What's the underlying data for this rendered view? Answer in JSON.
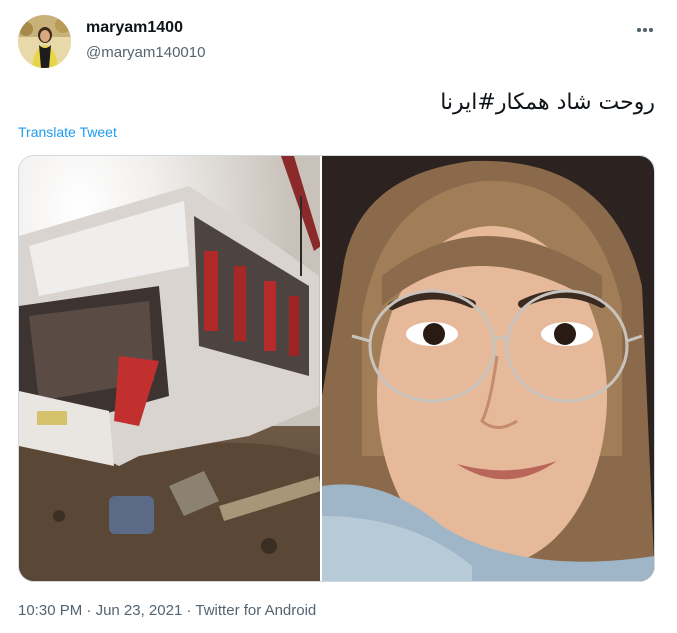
{
  "tweet": {
    "author": {
      "display_name": "maryam1400",
      "handle": "@maryam140010",
      "avatar_icon": "profile-avatar"
    },
    "more_icon": "more-options-icon",
    "text": "روحت شاد همکار#ایرنا",
    "translate_label": "Translate Tweet",
    "media": [
      {
        "icon": "photo-bus-wreckage"
      },
      {
        "icon": "photo-woman-portrait"
      }
    ],
    "timestamp": {
      "time": "10:30 PM",
      "separator": "·",
      "date": "Jun 23, 2021",
      "source": "Twitter for Android"
    }
  },
  "colors": {
    "link": "#1d9bf0",
    "secondary_text": "#536471",
    "border": "#cfd9de",
    "text": "#0f1419"
  }
}
